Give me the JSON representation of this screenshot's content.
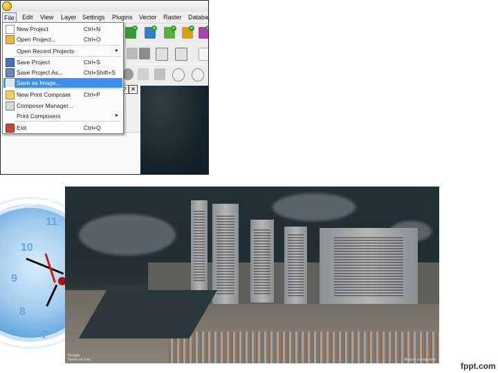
{
  "menubar": {
    "items": [
      "File",
      "Edit",
      "View",
      "Layer",
      "Settings",
      "Plugins",
      "Vector",
      "Raster",
      "Databa"
    ]
  },
  "file_menu": {
    "items": [
      {
        "label": "New Project",
        "shortcut": "Ctrl+N",
        "icon": "new-document-icon"
      },
      {
        "label": "Open Project...",
        "shortcut": "Ctrl+O",
        "icon": "open-folder-icon"
      },
      {
        "label": "Open Recent Projects",
        "shortcut": "",
        "submenu": true
      },
      {
        "label": "Save Project",
        "shortcut": "Ctrl+S",
        "icon": "save-icon"
      },
      {
        "label": "Save Project As...",
        "shortcut": "Ctrl+Shift+S",
        "icon": "save-as-icon"
      },
      {
        "label": "Save as Image...",
        "shortcut": "",
        "icon": "save-image-icon",
        "selected": true
      },
      {
        "label": "New Print Composer",
        "shortcut": "Ctrl+P",
        "icon": "new-composer-icon"
      },
      {
        "label": "Composer Manager...",
        "shortcut": "",
        "icon": "composer-manager-icon"
      },
      {
        "label": "Print Composers",
        "shortcut": "",
        "submenu": true
      },
      {
        "label": "Exit",
        "shortcut": "Ctrl+Q",
        "icon": "exit-icon"
      }
    ],
    "submenu_arrow": "▸",
    "selection_color": "#3d8fe8"
  },
  "toolbar": {
    "colors": [
      "#3a9a3a",
      "#2f7fcf",
      "#58b23a",
      "#2f7fcf",
      "#d8a018",
      "#b03fb6"
    ]
  },
  "panel": {
    "help_glyph": "?",
    "close_glyph": "✕"
  },
  "satellite": {
    "attribution_left_1": "Google",
    "attribution_left_2": "Terms of Use",
    "attribution_right": "Report a map error"
  },
  "clock_numbers": [
    "11",
    "10",
    "9",
    "8",
    "7"
  ],
  "footer": {
    "logo": "fppt.com"
  }
}
